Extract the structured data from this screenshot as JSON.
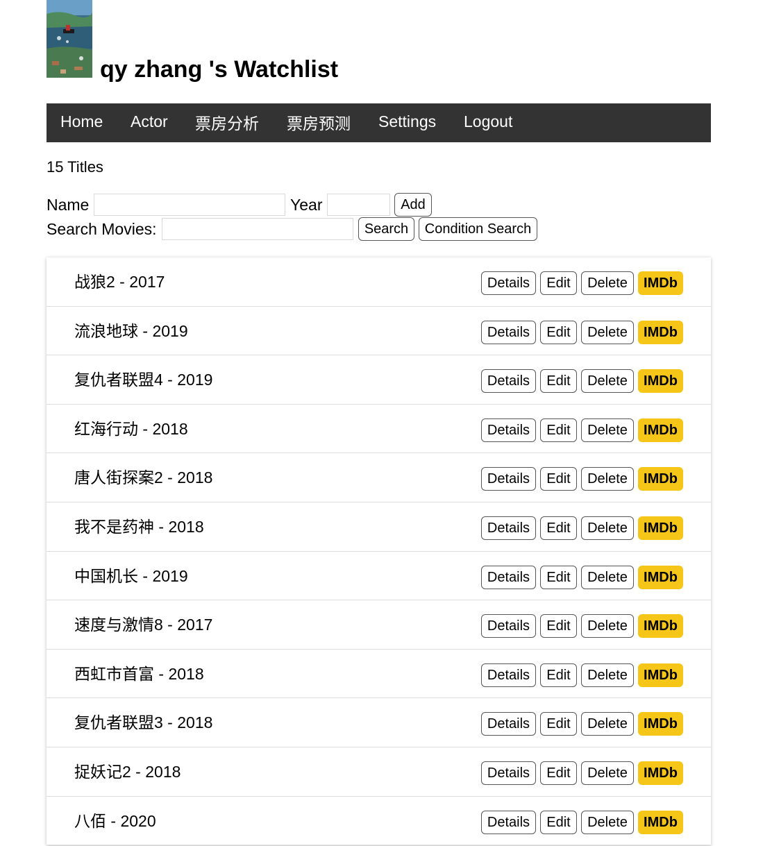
{
  "header": {
    "title": "qy zhang 's Watchlist"
  },
  "nav": {
    "items": [
      {
        "label": "Home"
      },
      {
        "label": "Actor"
      },
      {
        "label": "票房分析"
      },
      {
        "label": "票房预测"
      },
      {
        "label": "Settings"
      },
      {
        "label": "Logout"
      }
    ]
  },
  "count_text": "15 Titles",
  "add_form": {
    "name_label": "Name",
    "name_value": "",
    "year_label": "Year",
    "year_value": "",
    "add_label": "Add"
  },
  "search_form": {
    "label": "Search Movies:",
    "value": "",
    "search_label": "Search",
    "condition_label": "Condition Search"
  },
  "row_buttons": {
    "details": "Details",
    "edit": "Edit",
    "delete": "Delete",
    "imdb": "IMDb"
  },
  "colors": {
    "nav_bg": "#333333",
    "imdb_yellow": "#f5c518"
  },
  "movies": [
    {
      "title": "战狼2 - 2017"
    },
    {
      "title": "流浪地球 - 2019"
    },
    {
      "title": "复仇者联盟4 - 2019"
    },
    {
      "title": "红海行动 - 2018"
    },
    {
      "title": "唐人街探案2 - 2018"
    },
    {
      "title": "我不是药神 - 2018"
    },
    {
      "title": "中国机长 - 2019"
    },
    {
      "title": "速度与激情8 - 2017"
    },
    {
      "title": "西虹市首富 - 2018"
    },
    {
      "title": "复仇者联盟3 - 2018"
    },
    {
      "title": "捉妖记2 - 2018"
    },
    {
      "title": "八佰 - 2020"
    }
  ]
}
